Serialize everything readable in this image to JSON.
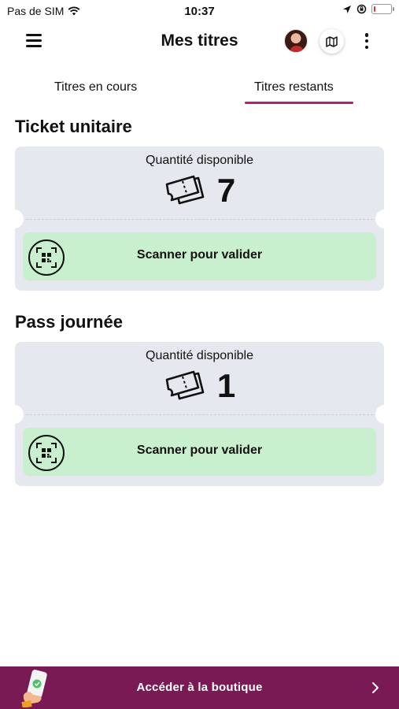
{
  "status_bar": {
    "carrier": "Pas de SIM",
    "time": "10:37",
    "battery_level": 0.1
  },
  "header": {
    "title": "Mes titres",
    "icons": [
      "menu-icon",
      "avatar",
      "map-icon",
      "more-vertical-icon"
    ]
  },
  "tabs": [
    {
      "label": "Titres en cours",
      "active": false
    },
    {
      "label": "Titres restants",
      "active": true
    }
  ],
  "tickets": [
    {
      "title": "Ticket unitaire",
      "quantity_label": "Quantité disponible",
      "quantity": "7",
      "scan_label": "Scanner pour valider"
    },
    {
      "title": "Pass journée",
      "quantity_label": "Quantité disponible",
      "quantity": "1",
      "scan_label": "Scanner pour valider"
    }
  ],
  "shop": {
    "label": "Accéder à la boutique"
  },
  "colors": {
    "accent": "#c5177a",
    "shop_bar": "#7a1a55",
    "card_bg": "#e6e8ef",
    "scan_bg": "#c9f0ce",
    "battery_low": "#e0333c"
  }
}
